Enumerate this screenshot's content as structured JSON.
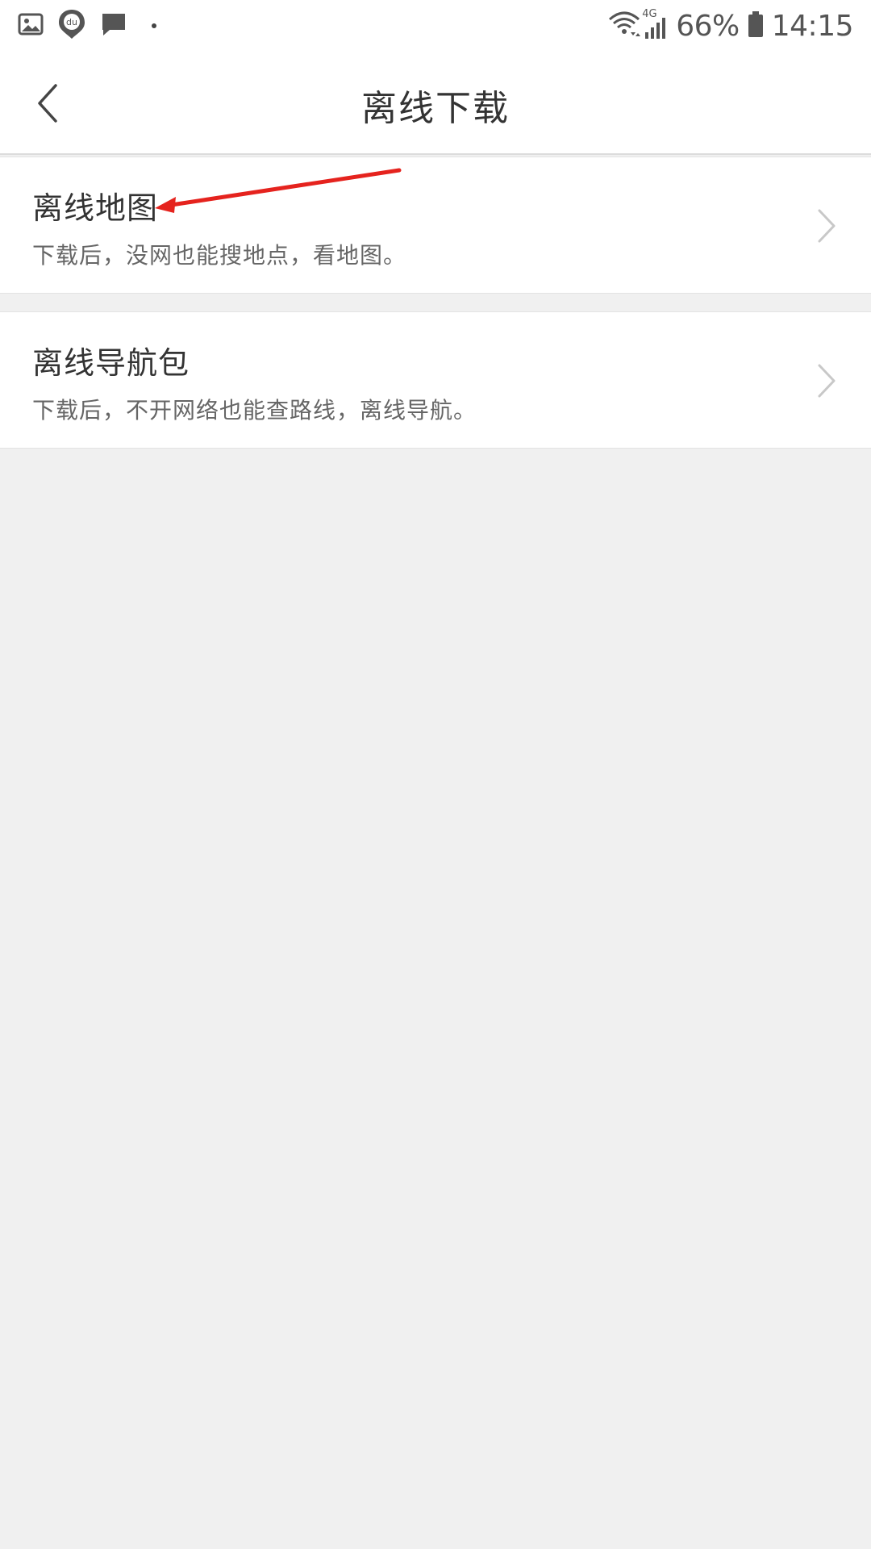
{
  "status_bar": {
    "left_icons": [
      "gallery-icon",
      "baidu-maps-icon",
      "message-icon",
      "dot-indicator"
    ],
    "network": "4G",
    "battery_percent": "66%",
    "time": "14:15"
  },
  "header": {
    "back_icon": "chevron-left-icon",
    "title": "离线下载"
  },
  "items": [
    {
      "title": "离线地图",
      "description": "下载后，没网也能搜地点，看地图。",
      "icon": "chevron-right-icon"
    },
    {
      "title": "离线导航包",
      "description": "下载后，不开网络也能查路线，离线导航。",
      "icon": "chevron-right-icon"
    }
  ],
  "colors": {
    "background": "#f0f0f0",
    "card": "#ffffff",
    "title_text": "#333333",
    "secondary_text": "#666666",
    "annotation_arrow": "#e5231e"
  }
}
